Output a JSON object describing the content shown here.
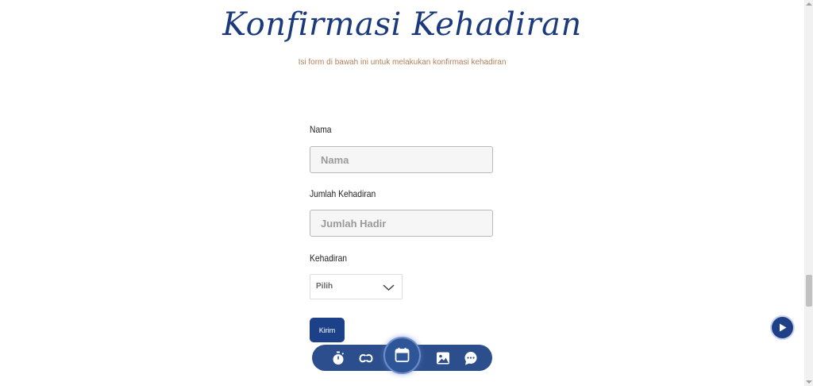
{
  "header": {
    "title": "Konfirmasi Kehadiran",
    "subtitle": "Isi form di bawah ini untuk melakukan konfirmasi kehadiran"
  },
  "form": {
    "name_label": "Nama",
    "name_placeholder": "Nama",
    "name_value": "",
    "attendance_count_label": "Jumlah Kehadiran",
    "attendance_count_placeholder": "Jumlah Hadir",
    "attendance_count_value": "",
    "attendance_label": "Kehadiran",
    "attendance_selected": "Pilih",
    "submit_label": "Kirim"
  },
  "bottom_nav": {
    "items": [
      {
        "icon": "stopwatch-icon"
      },
      {
        "icon": "couple-icon"
      },
      {
        "icon": "calendar-icon",
        "active": true
      },
      {
        "icon": "gallery-icon"
      },
      {
        "icon": "chat-icon"
      }
    ]
  },
  "music_button": {
    "icon": "play-icon"
  },
  "colors": {
    "accent": "#1d4189",
    "title": "#1b3a7c",
    "subtitle": "#b0805a",
    "navbar": "#2d4e8c"
  }
}
